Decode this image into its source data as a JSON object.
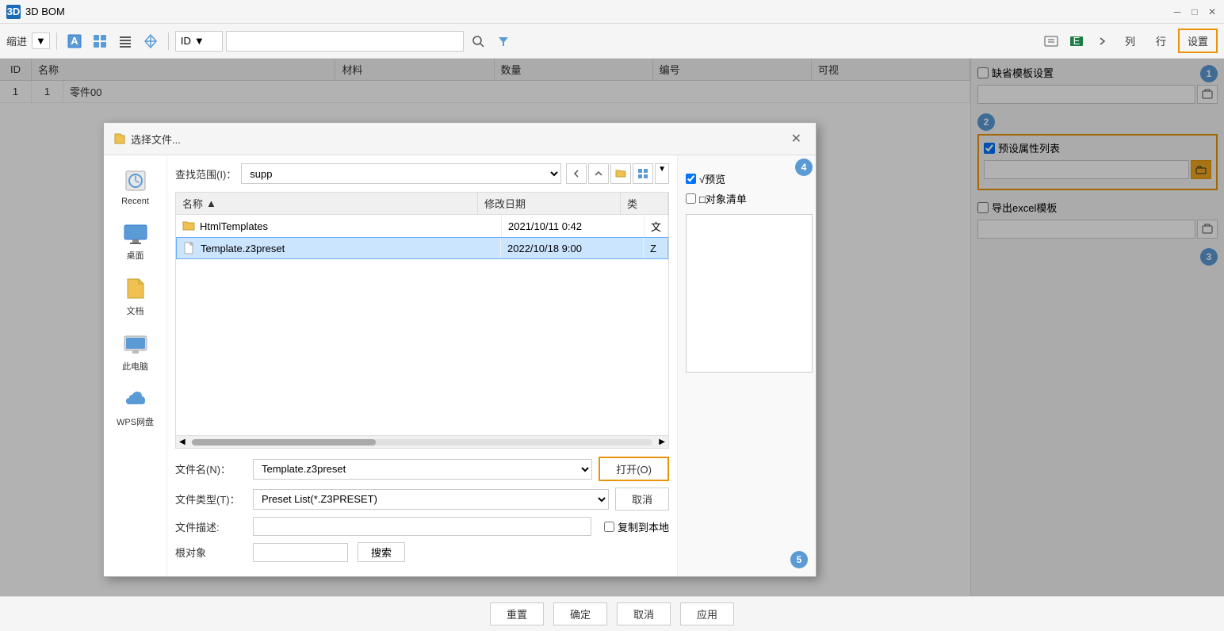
{
  "app": {
    "title": "3D BOM",
    "close_icon": "✕",
    "minimize_icon": "─",
    "restore_icon": "□"
  },
  "toolbar": {
    "dropdown_label": "ID",
    "search_placeholder": "",
    "collapse_label": "缩进",
    "tab_col": "列",
    "tab_row": "行",
    "tab_settings": "设置"
  },
  "table": {
    "headers": [
      "ID",
      "名称",
      "材料",
      "数量",
      "编号",
      "可视"
    ],
    "rows": [
      [
        "1",
        "1",
        "零件00",
        "",
        "",
        "",
        ""
      ]
    ]
  },
  "right_panel": {
    "badge1": "1",
    "badge2": "2",
    "badge3": "3",
    "section1": {
      "label": "缺省模板设置",
      "checkbox_checked": false
    },
    "section2": {
      "label": "预设属性列表",
      "checkbox_checked": true
    },
    "section3": {
      "label": "导出excel模板",
      "checkbox_checked": false
    }
  },
  "bottom_bar": {
    "reset": "重置",
    "ok": "确定",
    "cancel": "取消",
    "apply": "应用"
  },
  "dialog": {
    "title": "选择文件...",
    "close": "✕",
    "location_label": "查找范围(I)：",
    "location_value": "supp",
    "columns": {
      "name": "名称",
      "name_sort": "▲",
      "modified": "修改日期",
      "type": "类"
    },
    "files": [
      {
        "icon": "folder",
        "name": "HtmlTemplates",
        "modified": "2021/10/11 0:42",
        "type": "文",
        "selected": false
      },
      {
        "icon": "file",
        "name": "Template.z3preset",
        "modified": "2022/10/18 9:00",
        "type": "Z",
        "selected": true
      }
    ],
    "filename_label": "文件名(N)：",
    "filename_value": "Template.z3preset",
    "filetype_label": "文件类型(T)：",
    "filetype_value": "Preset List(*.Z3PRESET)",
    "filedesc_label": "文件描述:",
    "rootobj_label": "根对象",
    "search_btn": "搜索",
    "copy_label": "复制到本地",
    "preview_label": "√预览",
    "objlist_label": "□对象清单",
    "open_btn": "打开(O)",
    "cancel_btn": "取消",
    "badge4": "4",
    "badge5": "5"
  }
}
